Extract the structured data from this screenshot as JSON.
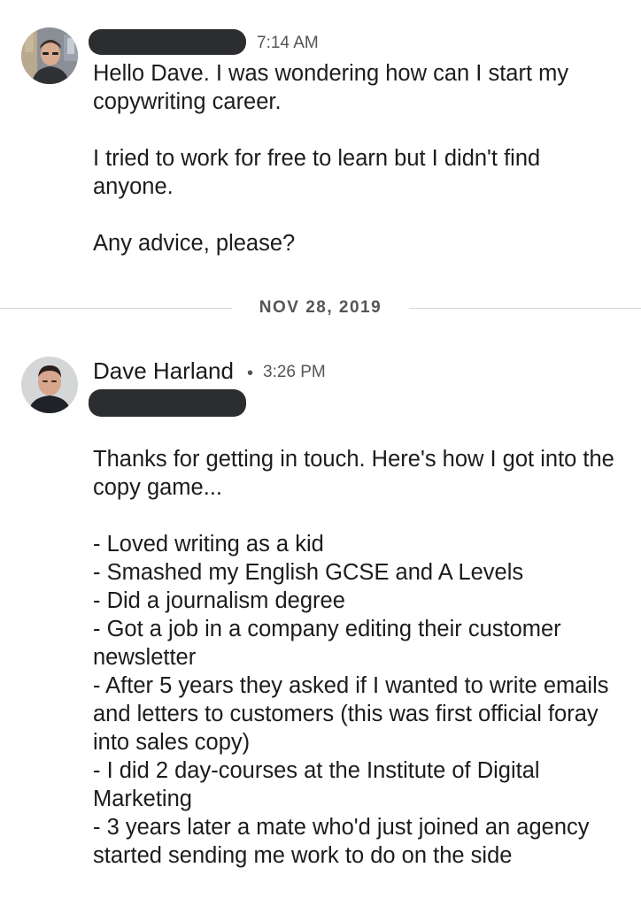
{
  "conversation": {
    "messages": [
      {
        "sender_name": "",
        "time": "7:14 AM",
        "avatar": "person-avatar-1",
        "text": "Hello Dave. I was wondering how can I start my copywriting career.\n\nI tried to work for free to learn but I didn't find anyone.\n\nAny advice, please?"
      },
      {
        "sender_name": "Dave Harland",
        "separator": "•",
        "time": "3:26 PM",
        "avatar": "person-avatar-2",
        "text": "Thanks for getting in touch. Here's how I got into the copy game...\n\n- Loved writing as a kid\n- Smashed my English GCSE and A Levels\n- Did a journalism degree\n- Got a job in a company editing their customer newsletter\n- After 5 years they asked if I wanted to write emails and letters to customers (this was first official foray into sales copy)\n- I did 2 day-courses at the Institute of Digital Marketing\n- 3 years later a mate who'd just joined an agency started sending me work to do on the side"
      }
    ],
    "date_divider": "NOV 28, 2019"
  },
  "colors": {
    "redaction": "#2b2d30",
    "divider": "#d6d6d6",
    "meta_text": "#555555"
  }
}
